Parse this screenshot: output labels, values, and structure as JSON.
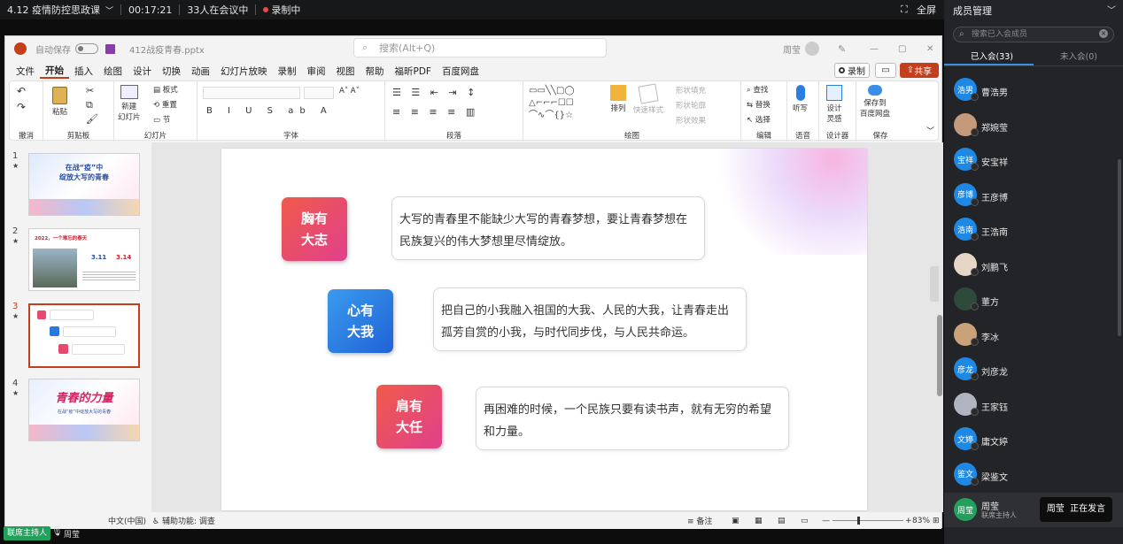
{
  "meeting": {
    "title": "4.12 疫情防控思政课",
    "duration": "00:17:21",
    "participants_status": "33人在会议中",
    "recording": "录制中",
    "fullscreen": "全屏"
  },
  "ppt": {
    "autosave": "自动保存",
    "filename": "412战疫青春.pptx",
    "search_placeholder": "搜索(Alt+Q)",
    "user": "周莹",
    "menu": [
      "文件",
      "开始",
      "插入",
      "绘图",
      "设计",
      "切换",
      "动画",
      "幻灯片放映",
      "录制",
      "审阅",
      "视图",
      "帮助",
      "福昕PDF",
      "百度网盘"
    ],
    "record_btn": "录制",
    "share_btn": "共享",
    "ribbon": {
      "undo": "撤消",
      "paste": "粘贴",
      "clipboard": "剪贴板",
      "new_slide": "新建",
      "new_slide2": "幻灯片",
      "layout": "板式",
      "reset": "重置",
      "section": "节",
      "slides": "幻灯片",
      "font": "字体",
      "paragraph": "段落",
      "arrange": "排列",
      "quick_styles": "快速样式",
      "shape_fill": "形状填充",
      "shape_outline": "形状轮廓",
      "shape_effect": "形状效果",
      "drawing": "绘图",
      "find": "查找",
      "replace": "替换",
      "select": "选择",
      "editing": "编辑",
      "dictate": "听写",
      "voice": "语音",
      "designer": "设计",
      "designer2": "灵感",
      "designer_group": "设计器",
      "save_baidu": "保存到",
      "save_baidu2": "百度网盘",
      "save": "保存"
    },
    "thumbnails": [
      {
        "num": "1",
        "title_line1": "在战“疫”中",
        "title_line2": "绽放大写的青春"
      },
      {
        "num": "2",
        "title": "2022，一个难忘的春天",
        "d1": "3.11",
        "d2": "3.14"
      },
      {
        "num": "3"
      },
      {
        "num": "4",
        "title": "青春的力量",
        "sub": "在战“疫”中绽放大写的青春"
      }
    ],
    "slide": {
      "items": [
        {
          "tag_line1": "胸有",
          "tag_line2": "大志",
          "text": "大写的青春里不能缺少大写的青春梦想，要让青春梦想在民族复兴的伟大梦想里尽情绽放。"
        },
        {
          "tag_line1": "心有",
          "tag_line2": "大我",
          "text": "把自己的小我融入祖国的大我、人民的大我，让青春走出孤芳自赏的小我，与时代同步伐，与人民共命运。"
        },
        {
          "tag_line1": "肩有",
          "tag_line2": "大任",
          "text": "再困难的时候，一个民族只要有读书声，就有无穷的希望和力量。"
        }
      ]
    },
    "status": {
      "lang": "中文(中国)",
      "accessibility": "辅助功能: 调查",
      "notes": "备注",
      "zoom": "83%"
    }
  },
  "footer": {
    "host_badge": "联席主持人",
    "host_name": "周莹"
  },
  "sidebar": {
    "title": "成员管理",
    "search_placeholder": "搜索已入会成员",
    "tab_joined": "已入会(33)",
    "tab_not_joined": "未入会(0)",
    "members": [
      {
        "avatar": "浩男",
        "name": "曹浩男"
      },
      {
        "avatar": "",
        "name": "郑婉莹"
      },
      {
        "avatar": "宝祥",
        "name": "安宝祥"
      },
      {
        "avatar": "彦博",
        "name": "王彦博"
      },
      {
        "avatar": "浩南",
        "name": "王浩南"
      },
      {
        "avatar": "",
        "name": "刘鹏飞"
      },
      {
        "avatar": "",
        "name": "董方"
      },
      {
        "avatar": "",
        "name": "李冰"
      },
      {
        "avatar": "彦龙",
        "name": "刘彦龙"
      },
      {
        "avatar": "",
        "name": "王家钰"
      },
      {
        "avatar": "文婷",
        "name": "庸文婷"
      },
      {
        "avatar": "鉴文",
        "name": "梁鉴文"
      }
    ],
    "self": {
      "avatar": "周莹",
      "name": "周莹",
      "role": "联席主持人"
    },
    "speaking": "周莹  正在发言"
  },
  "colors": {
    "accent": "#c43e1c",
    "tag_red": [
      "#f04a5a",
      "#e0408c"
    ],
    "tag_blue": [
      "#2e90ea",
      "#2468d8"
    ]
  }
}
